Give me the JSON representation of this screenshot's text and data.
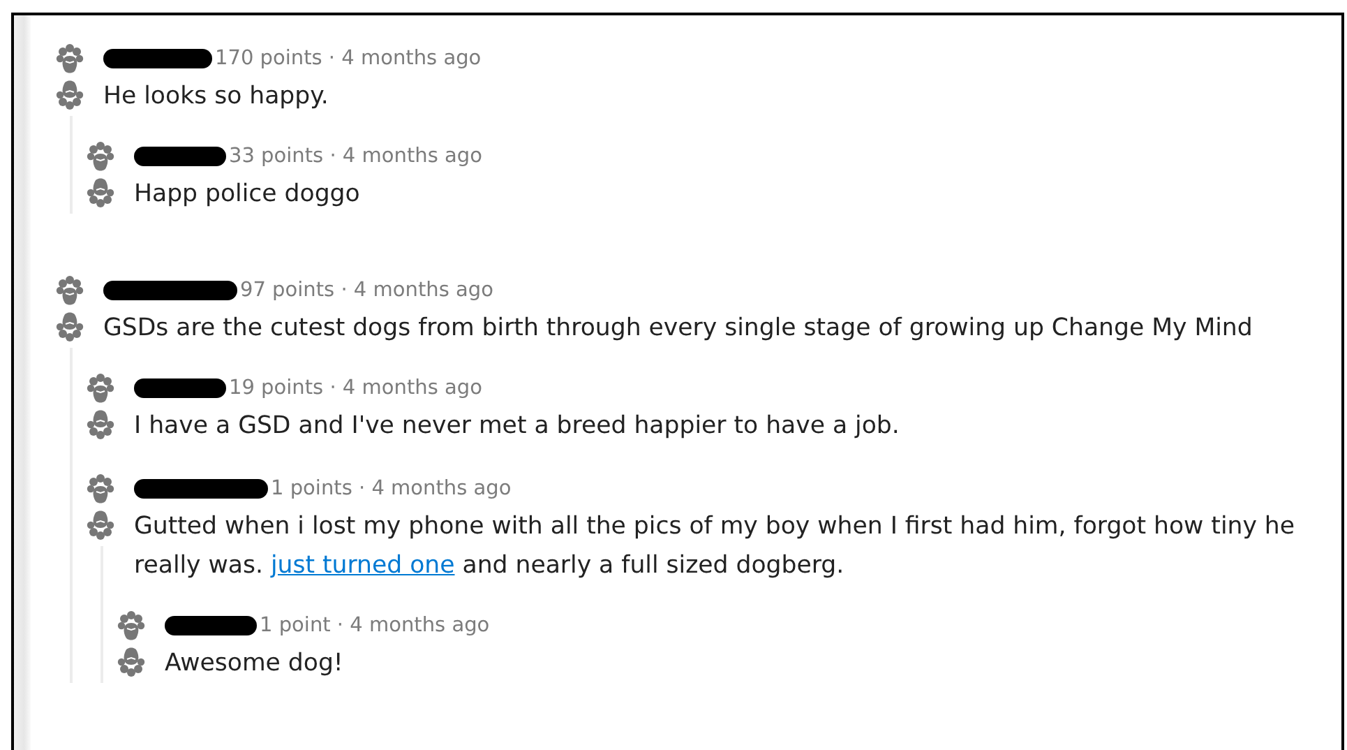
{
  "comments": [
    {
      "meta": "170 points · 4 months ago",
      "body": [
        {
          "kind": "text",
          "text": "He looks so happy."
        }
      ],
      "children": [
        {
          "meta": "33 points · 4 months ago",
          "body": [
            {
              "kind": "text",
              "text": "Happ police doggo"
            }
          ]
        }
      ]
    },
    {
      "meta": "97 points · 4 months ago",
      "body": [
        {
          "kind": "text",
          "text": "GSDs are the cutest dogs from birth through every single stage of growing up Change My Mind"
        }
      ],
      "children": [
        {
          "meta": "19 points · 4 months ago",
          "body": [
            {
              "kind": "text",
              "text": "I have a GSD and I've never met a breed happier to have a job."
            }
          ]
        },
        {
          "meta": "1 points · 4 months ago",
          "body": [
            {
              "kind": "text",
              "text": "Gutted when i lost my phone with all the pics of my boy when I first had him, forgot how tiny he really was. "
            },
            {
              "kind": "link",
              "text": "just turned one"
            },
            {
              "kind": "text",
              "text": " and nearly a full sized dogberg."
            }
          ],
          "children": [
            {
              "meta": "1 point · 4 months ago",
              "body": [
                {
                  "kind": "text",
                  "text": "Awesome dog!"
                }
              ]
            }
          ]
        }
      ]
    }
  ]
}
